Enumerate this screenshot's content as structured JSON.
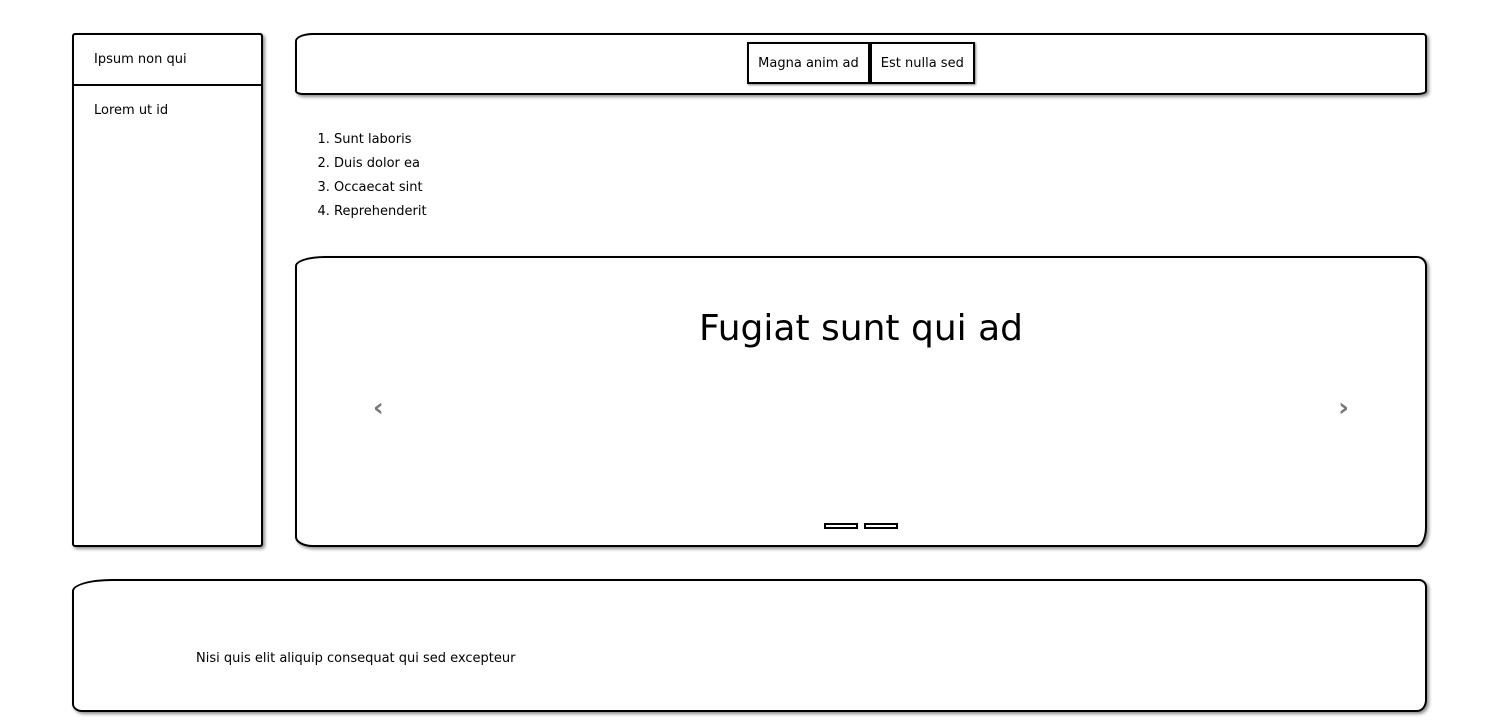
{
  "sidebar": {
    "items": [
      {
        "label": "Ipsum non qui"
      },
      {
        "label": "Lorem ut id"
      }
    ]
  },
  "topbar": {
    "buttons": [
      {
        "label": "Magna anim ad"
      },
      {
        "label": "Est nulla sed"
      }
    ]
  },
  "list": {
    "items": [
      "Sunt laboris",
      "Duis dolor ea",
      "Occaecat sint",
      "Reprehenderit"
    ]
  },
  "carousel": {
    "title": "Fugiat sunt qui ad",
    "prev_icon": "chevron-left-icon",
    "next_icon": "chevron-right-icon",
    "prev_glyph": "‹",
    "next_glyph": "›",
    "slide_count": 2
  },
  "footer": {
    "text": "Nisi quis elit aliquip consequat qui sed excepteur"
  }
}
